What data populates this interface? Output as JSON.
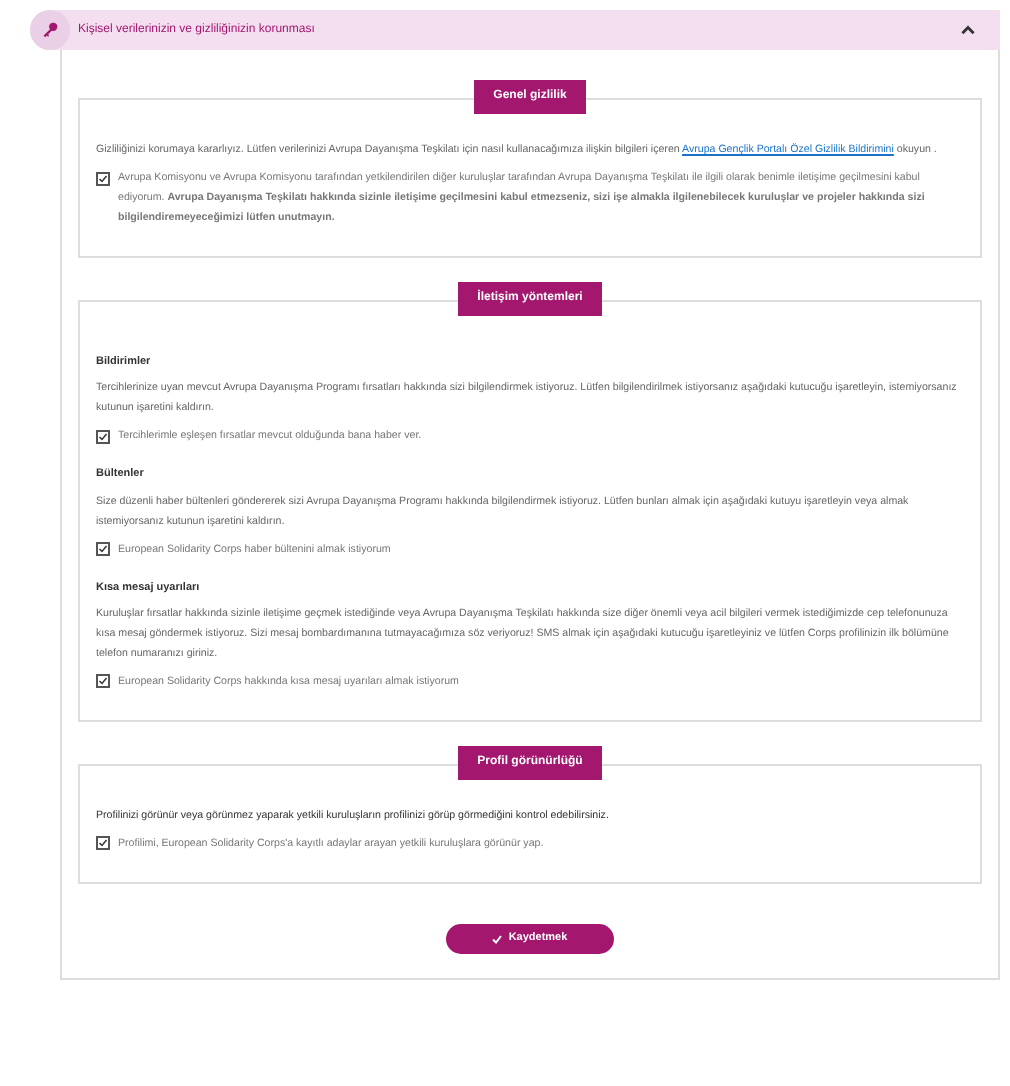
{
  "header": {
    "title": "Kişisel verilerinizin ve gizliliğinizin korunması",
    "expanded": true
  },
  "sections": [
    {
      "title": "Genel gizlilik",
      "blocks": [
        {
          "kind": "paragraph",
          "text": "Gizliliğinizi korumaya kararlıyız. Lütfen verilerinizi Avrupa Dayanışma Teşkilatı için nasıl kullanacağımıza ilişkin bilgileri içeren ",
          "link": "Avrupa Gençlik Portalı Özel Gizlilik Bildirimini",
          "after": " okuyun ."
        },
        {
          "kind": "checkbox",
          "checked": true,
          "text": "Avrupa Komisyonu ve Avrupa Komisyonu tarafından yetkilendirilen diğer kuruluşlar tarafından Avrupa Dayanışma Teşkilatı ile ilgili olarak benimle iletişime geçilmesini kabul ediyorum. **Avrupa Dayanışma Teşkilatı hakkında sizinle iletişime geçilmesini kabul etmezseniz, sizi işe almakla ilgilenebilecek kuruluşlar ve projeler hakkında sizi bilgilendiremeyeceğimizi lütfen unutmayın.**"
        }
      ]
    },
    {
      "title": "İletişim yöntemleri",
      "blocks": [
        {
          "kind": "heading",
          "text": "Bildirimler"
        },
        {
          "kind": "paragraph",
          "text": "Tercihlerinize uyan mevcut Avrupa Dayanışma Programı fırsatları hakkında sizi bilgilendirmek istiyoruz. Lütfen bilgilendirilmek istiyorsanız aşağıdaki kutucuğu işaretleyin, istemiyorsanız kutunun işaretini kaldırın."
        },
        {
          "kind": "checkbox",
          "checked": true,
          "text": "Tercihlerimle eşleşen fırsatlar mevcut olduğunda bana haber ver."
        },
        {
          "kind": "heading",
          "text": "Bültenler"
        },
        {
          "kind": "paragraph",
          "text": "Size düzenli haber bültenleri göndererek sizi Avrupa Dayanışma Programı hakkında bilgilendirmek istiyoruz. Lütfen bunları almak için aşağıdaki kutuyu işaretleyin veya almak istemiyorsanız kutunun işaretini kaldırın."
        },
        {
          "kind": "checkbox",
          "checked": true,
          "text": "European Solidarity Corps haber bültenini almak istiyorum"
        },
        {
          "kind": "heading",
          "text": "Kısa mesaj uyarıları"
        },
        {
          "kind": "paragraph",
          "text": "Kuruluşlar fırsatlar hakkında sizinle iletişime geçmek istediğinde veya Avrupa Dayanışma Teşkilatı hakkında size diğer önemli veya acil bilgileri vermek istediğimizde cep telefonunuza kısa mesaj göndermek istiyoruz. Sizi mesaj bombardımanına tutmayacağımıza söz veriyoruz! SMS almak için aşağıdaki kutucuğu işaretleyiniz ve lütfen Corps profilinizin ilk bölümüne telefon numaranızı giriniz."
        },
        {
          "kind": "checkbox",
          "checked": true,
          "text": "European Solidarity Corps hakkında kısa mesaj uyarıları almak istiyorum"
        }
      ]
    },
    {
      "title": "Profil görünürlüğü",
      "blocks": [
        {
          "kind": "lead",
          "text": "Profilinizi görünür veya görünmez yaparak yetkili kuruluşların profilinizi görüp görmediğini kontrol edebilirsiniz."
        },
        {
          "kind": "checkbox",
          "checked": true,
          "text": "Profilimi, European Solidarity Corps'a kayıtlı adaylar arayan yetkili kuruluşlara görünür yap."
        }
      ]
    }
  ],
  "save_button": "Kaydetmek"
}
